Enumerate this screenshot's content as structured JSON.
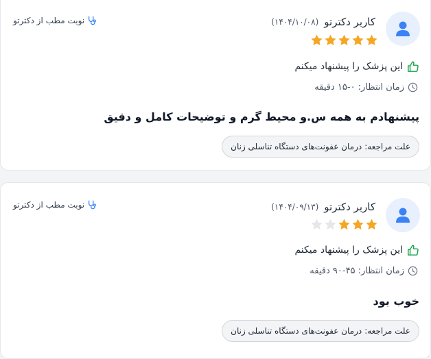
{
  "reviews": [
    {
      "user_name": "کاربر دکترتو",
      "date": "(۱۴۰۴/۱۰/۰۸)",
      "rating": 5,
      "rating_max": 5,
      "booking_label": "نوبت مطب از دکترتو",
      "recommend_text": "این پزشک را پیشنهاد میکنم",
      "wait_time": "زمان انتظار: ۰-۱۵ دقیقه",
      "comment": "پیشنهادم به همه س.و محیط گرم و توضیحات کامل و دقیق",
      "reason_label": "علت مراجعه:",
      "reason_value": "درمان عفونت‌های دستگاه تناسلی زنان"
    },
    {
      "user_name": "کاربر دکترتو",
      "date": "(۱۴۰۴/۰۹/۱۳)",
      "rating": 3,
      "rating_max": 5,
      "booking_label": "نوبت مطب از دکترتو",
      "recommend_text": "این پزشک را پیشنهاد میکنم",
      "wait_time": "زمان انتظار: ۴۵-۹۰ دقیقه",
      "comment": "خوب بود",
      "reason_label": "علت مراجعه:",
      "reason_value": "درمان عفونت‌های دستگاه تناسلی زنان"
    }
  ],
  "colors": {
    "star_filled": "#f5a623",
    "star_empty": "#e5e7eb",
    "thumb_green": "#16a34a",
    "avatar_bg": "#e8f0fd",
    "avatar_fg": "#3b82f6",
    "stethoscope_blue": "#3b82f6"
  },
  "icons": {
    "avatar": "user-icon",
    "booking": "stethoscope-icon",
    "recommend": "thumbs-up-icon",
    "wait": "clock-icon",
    "rating": "star-icon"
  }
}
